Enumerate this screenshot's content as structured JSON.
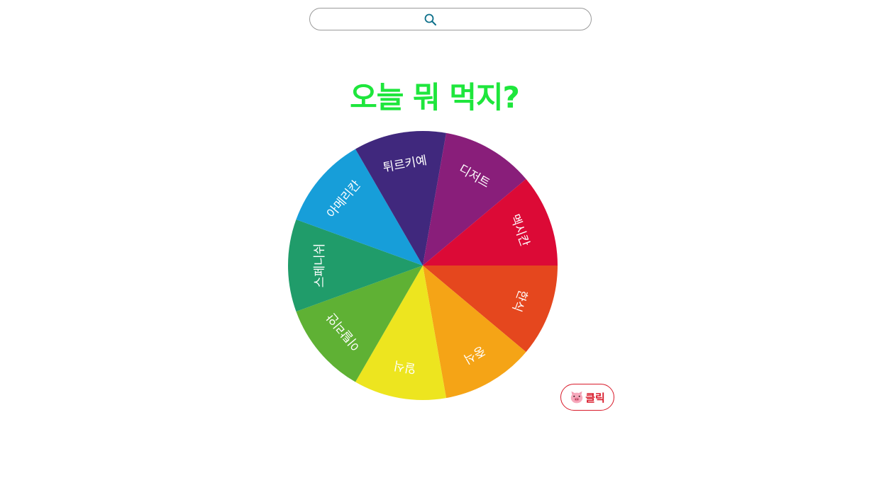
{
  "search": {
    "placeholder": "",
    "value": ""
  },
  "title": {
    "text": "오늘 뭐 먹지?",
    "color": "#1ee63c"
  },
  "wheel": {
    "slices": [
      {
        "label": "한식",
        "color": "#e5471e"
      },
      {
        "label": "중식",
        "color": "#f5a416"
      },
      {
        "label": "일식",
        "color": "#ede51f"
      },
      {
        "label": "이탈리안",
        "color": "#5fb134"
      },
      {
        "label": "스페니쉬",
        "color": "#209c6a"
      },
      {
        "label": "아메리칸",
        "color": "#179ed9"
      },
      {
        "label": "튀르키예",
        "color": "#40287d"
      },
      {
        "label": "디저트",
        "color": "#891e7a"
      },
      {
        "label": "멕시칸",
        "color": "#dc0a36"
      }
    ]
  },
  "spin_button": {
    "label": "클릭",
    "icon": "pig-face-icon",
    "text_color": "#d91a2a",
    "border_color": "#d91a2a"
  }
}
